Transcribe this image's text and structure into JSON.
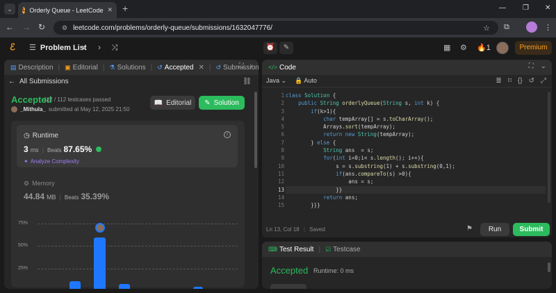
{
  "browser": {
    "tab_title": "Orderly Queue - LeetCode",
    "url": "leetcode.com/problems/orderly-queue/submissions/1632047776/"
  },
  "nav": {
    "problem_list": "Problem List",
    "streak": "1",
    "premium": "Premium"
  },
  "left_tabs": [
    {
      "label": "Description"
    },
    {
      "label": "Editorial"
    },
    {
      "label": "Solutions"
    },
    {
      "label": "Accepted"
    },
    {
      "label": "Submission"
    }
  ],
  "submission": {
    "back_label": "All Submissions",
    "status": "Accepted",
    "testcases": "112 / 112 testcases passed",
    "user": "_Mithula_",
    "submitted_text": "submitted at May 12, 2025 21:50",
    "editorial_btn": "Editorial",
    "solution_btn": "Solution"
  },
  "runtime": {
    "title": "Runtime",
    "value": "3",
    "unit": "ms",
    "beats_label": "Beats",
    "beats": "87.65%",
    "analyze": "Analyze Complexity"
  },
  "memory": {
    "title": "Memory",
    "value": "44.84",
    "unit": "MB",
    "beats_label": "Beats",
    "beats": "35.39%"
  },
  "chart": {
    "y_labels": [
      "75%",
      "50%",
      "25%"
    ]
  },
  "code_panel": {
    "title": "Code",
    "language": "Java",
    "mode": "Auto",
    "status": "Ln 13, Col 18",
    "saved": "Saved",
    "run": "Run",
    "submit": "Submit"
  },
  "test_panel": {
    "tab1": "Test Result",
    "tab2": "Testcase",
    "status": "Accepted",
    "runtime": "Runtime: 0 ms"
  },
  "colors": {
    "accent_green": "#2cbb5d",
    "brand_orange": "#ffa116",
    "bar_blue": "#1e78ff"
  }
}
